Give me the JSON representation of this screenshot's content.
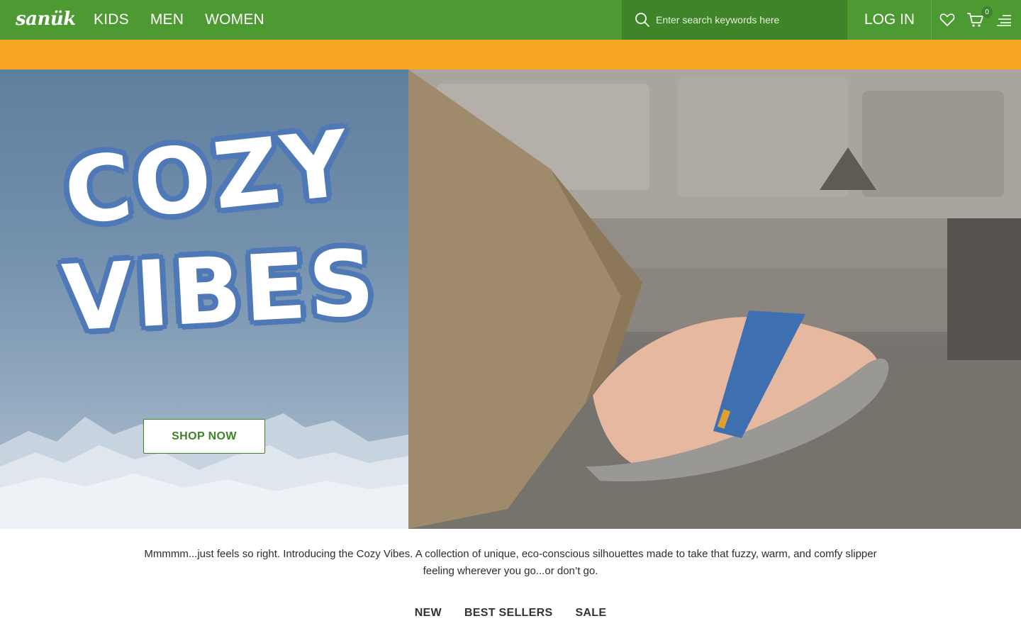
{
  "header": {
    "logo_text": "sanük",
    "nav": [
      {
        "label": "KIDS"
      },
      {
        "label": "MEN"
      },
      {
        "label": "WOMEN"
      }
    ],
    "search": {
      "placeholder": "Enter search keywords here",
      "icon": "search-icon"
    },
    "login_label": "LOG IN",
    "cart_count": "0",
    "icons": [
      "heart-icon",
      "cart-icon",
      "menu-icon"
    ],
    "colors": {
      "header_bg": "#4d9a33",
      "promo_bg": "#f6a623",
      "accent": "#3f8428"
    }
  },
  "hero": {
    "headline_line1": "COZY",
    "headline_line2": "VIBES",
    "cta_label": "SHOP NOW"
  },
  "description": "Mmmmm...just feels so right. Introducing the Cozy Vibes. A collection of unique, eco-conscious silhouettes made to take that fuzzy, warm, and comfy slipper feeling wherever you go...or don’t go.",
  "tabs": [
    {
      "label": "NEW"
    },
    {
      "label": "BEST SELLERS"
    },
    {
      "label": "SALE"
    }
  ]
}
